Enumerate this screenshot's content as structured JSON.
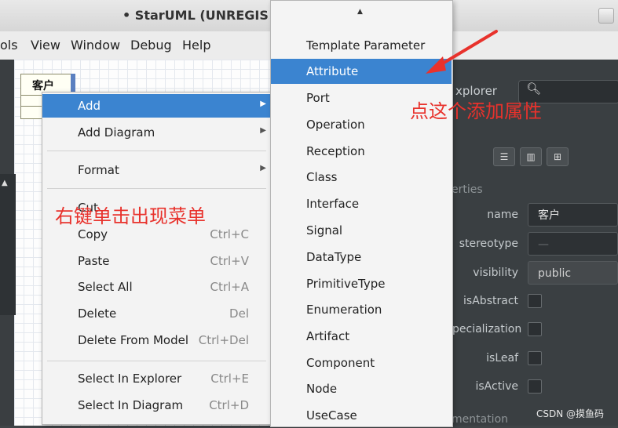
{
  "window": {
    "title": "• StarUML (UNREGIS"
  },
  "menubar": [
    "ols",
    "View",
    "Window",
    "Debug",
    "Help"
  ],
  "diagram": {
    "class_name": "客户"
  },
  "explorer": {
    "label": "xplorer"
  },
  "properties": {
    "section_label": "erties",
    "rows": [
      {
        "label": "name",
        "value": "客户",
        "kind": "field"
      },
      {
        "label": "stereotype",
        "value": "—",
        "kind": "field"
      },
      {
        "label": "visibility",
        "value": "public",
        "kind": "select"
      },
      {
        "label": "isAbstract",
        "kind": "checkbox"
      },
      {
        "label": "pecialization",
        "kind": "checkbox"
      },
      {
        "label": "isLeaf",
        "kind": "checkbox"
      },
      {
        "label": "isActive",
        "kind": "checkbox"
      }
    ],
    "doc_label": "mentation"
  },
  "context_menu": {
    "items": [
      {
        "label": "Add",
        "submenu": true,
        "active": true
      },
      {
        "label": "Add Diagram",
        "submenu": true
      },
      {
        "label": "Format",
        "submenu": true
      },
      {
        "label": "Cut",
        "shortcut": ""
      },
      {
        "label": "Copy",
        "shortcut": "Ctrl+C"
      },
      {
        "label": "Paste",
        "shortcut": "Ctrl+V"
      },
      {
        "label": "Select All",
        "shortcut": "Ctrl+A"
      },
      {
        "label": "Delete",
        "shortcut": "Del"
      },
      {
        "label": "Delete From Model",
        "shortcut": "Ctrl+Del"
      },
      {
        "label": "Select In Explorer",
        "shortcut": "Ctrl+E"
      },
      {
        "label": "Select In Diagram",
        "shortcut": "Ctrl+D"
      }
    ]
  },
  "submenu": {
    "items": [
      "Template Parameter",
      "Attribute",
      "Port",
      "Operation",
      "Reception",
      "Class",
      "Interface",
      "Signal",
      "DataType",
      "PrimitiveType",
      "Enumeration",
      "Artifact",
      "Component",
      "Node",
      "UseCase"
    ],
    "active_index": 1
  },
  "annotations": {
    "left_note": "右键单击出现菜单",
    "right_note": "点这个添加属性",
    "watermark": "CSDN @摸鱼码"
  },
  "colors": {
    "highlight": "#3b84d0",
    "annotation": "#e8322c"
  }
}
